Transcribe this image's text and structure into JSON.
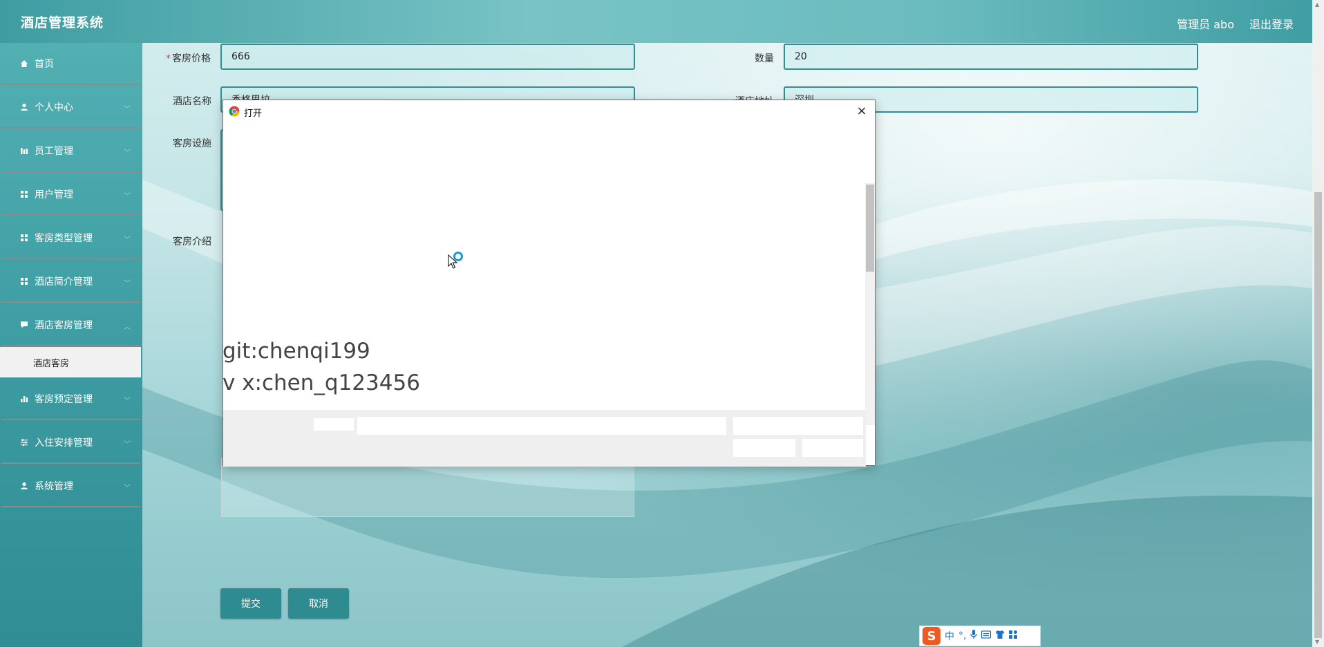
{
  "header": {
    "title": "酒店管理系统",
    "admin_label": "管理员 abo",
    "logout_label": "退出登录"
  },
  "sidebar": {
    "items": [
      {
        "label": "首页",
        "icon": "home-icon"
      },
      {
        "label": "个人中心",
        "icon": "user-icon"
      },
      {
        "label": "员工管理",
        "icon": "chart-icon"
      },
      {
        "label": "用户管理",
        "icon": "grid-icon"
      },
      {
        "label": "客房类型管理",
        "icon": "grid-icon"
      },
      {
        "label": "酒店简介管理",
        "icon": "grid-icon"
      },
      {
        "label": "酒店客房管理",
        "icon": "comment-icon"
      },
      {
        "label": "客房预定管理",
        "icon": "bar-chart-icon"
      },
      {
        "label": "入住安排管理",
        "icon": "sliders-icon"
      },
      {
        "label": "系统管理",
        "icon": "user-icon"
      }
    ],
    "active_sub_item": "酒店客房"
  },
  "form": {
    "price_label": "客房价格",
    "price_value": "666",
    "quantity_label": "数量",
    "quantity_value": "20",
    "hotel_name_label": "酒店名称",
    "hotel_name_value": "香格里拉",
    "hotel_address_label": "酒店地址",
    "hotel_address_value": "深圳",
    "facilities_label": "客房设施",
    "intro_label": "客房介绍",
    "submit_label": "提交",
    "cancel_label": "取消"
  },
  "dialog": {
    "title": "打开",
    "close_glyph": "×",
    "watermark_line1": "git:chenqi199",
    "watermark_line2": "v x:chen_q123456"
  },
  "ime": {
    "logo": "S",
    "mode": "中"
  },
  "colors": {
    "accent": "#2e8c91",
    "header_start": "#3e9da1",
    "spinner": "#1c97d8"
  }
}
